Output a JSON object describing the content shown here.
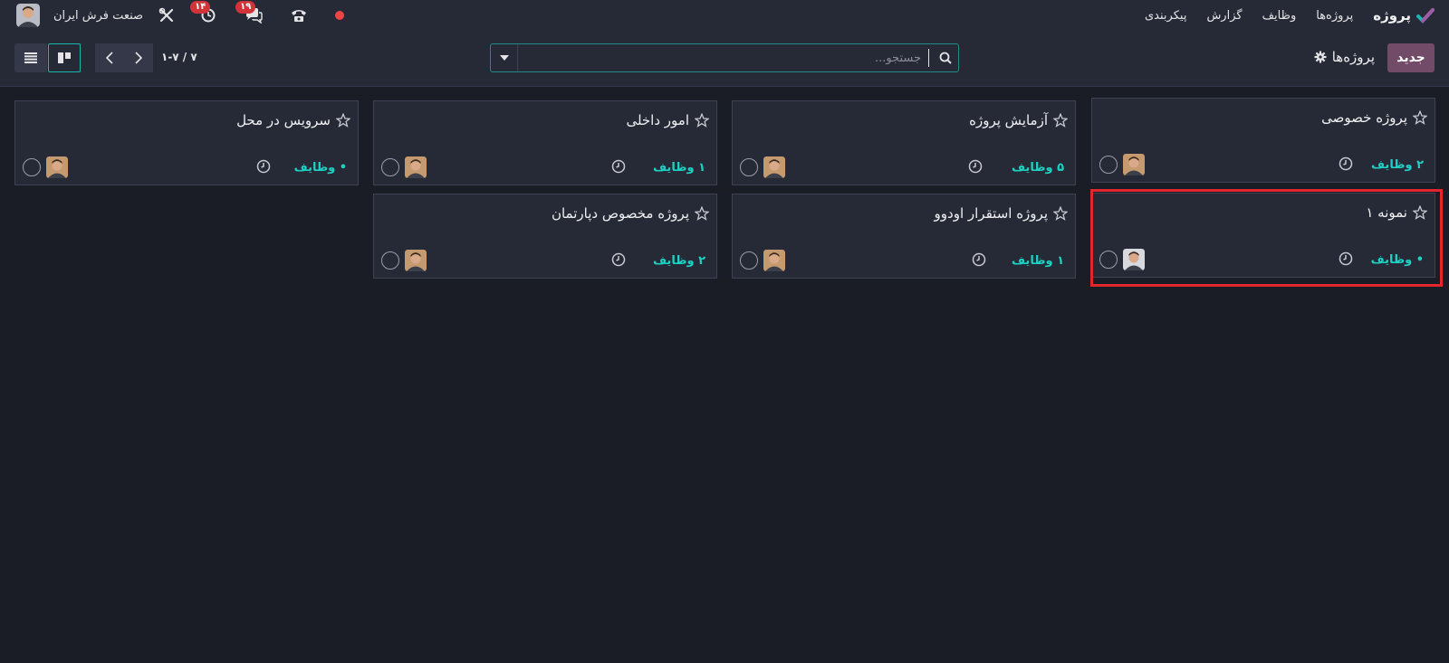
{
  "navbar": {
    "app_name": "پروژه",
    "menu": [
      "پروژه‌ها",
      "وظایف",
      "گزارش",
      "پیکربندی"
    ],
    "company": "صنعت فرش ایران",
    "activity_count": "۱۴",
    "messages_count": "۱۹",
    "status_color": "#f04545"
  },
  "control_panel": {
    "breadcrumb": "پروژه‌ها",
    "new_button": "جدید",
    "search_placeholder": "جستجو...",
    "pager": "۱-۷ / ۷"
  },
  "projects": [
    {
      "name": "پروژه خصوصی",
      "tasks": "۲ وظایف"
    },
    {
      "name": "آزمایش پروژه",
      "tasks": "۵ وظایف"
    },
    {
      "name": "امور داخلی",
      "tasks": "۱ وظایف"
    },
    {
      "name": "سرویس در محل",
      "tasks": "• وظایف"
    },
    {
      "name": "نمونه ۱",
      "tasks": "• وظایف"
    },
    {
      "name": "پروژه استقرار اودوو",
      "tasks": "۱ وظایف"
    },
    {
      "name": "پروژه مخصوص دپارتمان",
      "tasks": "۲ وظایف"
    }
  ],
  "colors": {
    "accent": "#1ed1c4",
    "primary": "#714b67",
    "highlight": "#e3262e"
  }
}
